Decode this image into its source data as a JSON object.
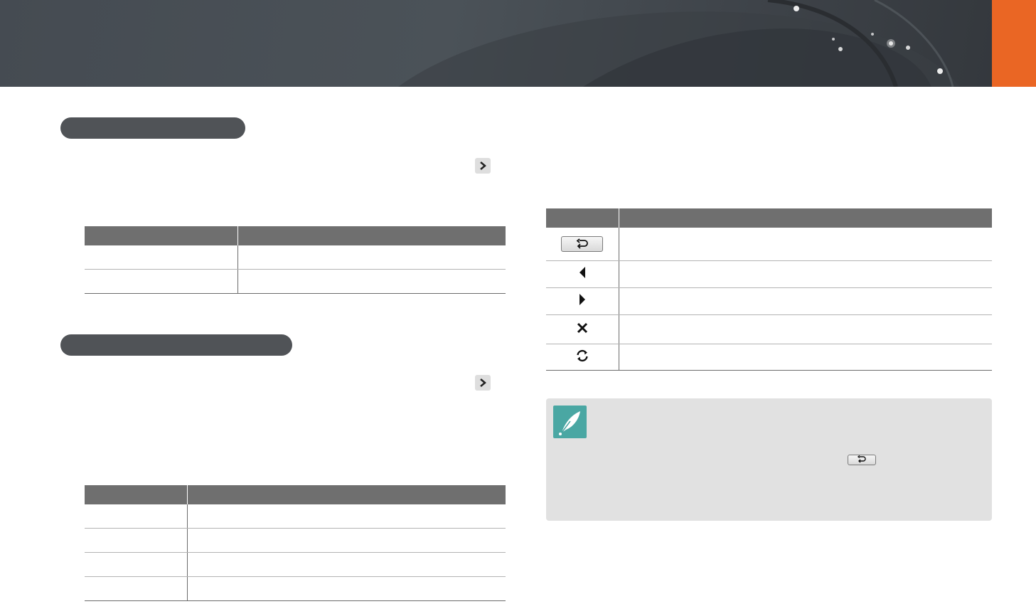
{
  "icons": {
    "header_tab": "orange-tab",
    "section_chevron": "chevron-right-icon",
    "back": "back-arrow-icon",
    "left": "triangle-left-icon",
    "right": "triangle-right-icon",
    "close": "close-icon",
    "refresh": "refresh-icon",
    "note": "pen-nib-icon"
  },
  "colors": {
    "accent": "#ea6624",
    "header": "#454b52",
    "pill": "#505357",
    "table_header": "#6f6f6f",
    "note_bg": "#e1e1e1",
    "note_icon": "#4aa7a3"
  },
  "section1": {
    "table": {
      "headers": [
        "",
        ""
      ],
      "rows": [
        [
          "",
          ""
        ],
        [
          "",
          ""
        ]
      ]
    }
  },
  "section2": {
    "table": {
      "headers": [
        "",
        ""
      ],
      "rows": [
        [
          "",
          ""
        ],
        [
          "",
          ""
        ],
        [
          "",
          ""
        ],
        [
          "",
          ""
        ]
      ]
    }
  },
  "controls_table": {
    "headers": [
      "",
      ""
    ],
    "rows": [
      {
        "icon": "back-arrow-icon",
        "text": ""
      },
      {
        "icon": "triangle-left-icon",
        "text": ""
      },
      {
        "icon": "triangle-right-icon",
        "text": ""
      },
      {
        "icon": "close-icon",
        "text": ""
      },
      {
        "icon": "refresh-icon",
        "text": ""
      }
    ]
  },
  "note": {
    "text": ""
  }
}
